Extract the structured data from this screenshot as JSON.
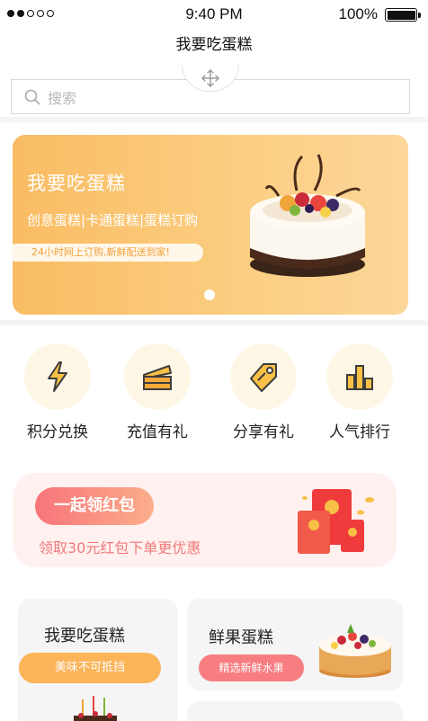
{
  "status_bar": {
    "time": "9:40 PM",
    "battery": "100%",
    "signal_dots_filled": 2,
    "signal_dots_total": 5
  },
  "nav": {
    "title": "我要吃蛋糕"
  },
  "search": {
    "placeholder": "搜索",
    "icon": "search-icon"
  },
  "banner": {
    "title": "我要吃蛋糕",
    "subtitle": "创意蛋糕|卡通蛋糕|蛋糕订购",
    "tagline": "24小时网上订购,新鲜配送到家!",
    "colors": {
      "from": "#f9bc63",
      "to": "#fdd79a"
    }
  },
  "categories": [
    {
      "label": "积分兑换",
      "icon": "lightning-icon"
    },
    {
      "label": "充值有礼",
      "icon": "cake-slice-icon"
    },
    {
      "label": "分享有礼",
      "icon": "tag-icon"
    },
    {
      "label": "人气排行",
      "icon": "bar-chart-icon"
    }
  ],
  "red_packet": {
    "button_label": "一起领红包",
    "text": "领取30元红包下单更优惠"
  },
  "products": [
    {
      "title": "我要吃蛋糕",
      "tag": "美味不可抵挡",
      "tag_color": "#fbb458"
    },
    {
      "title": "鲜果蛋糕",
      "tag": "精选新鲜水果",
      "tag_color": "#f77d80"
    }
  ],
  "colors": {
    "accent_orange": "#f9bc63",
    "accent_red": "#f77d80"
  }
}
